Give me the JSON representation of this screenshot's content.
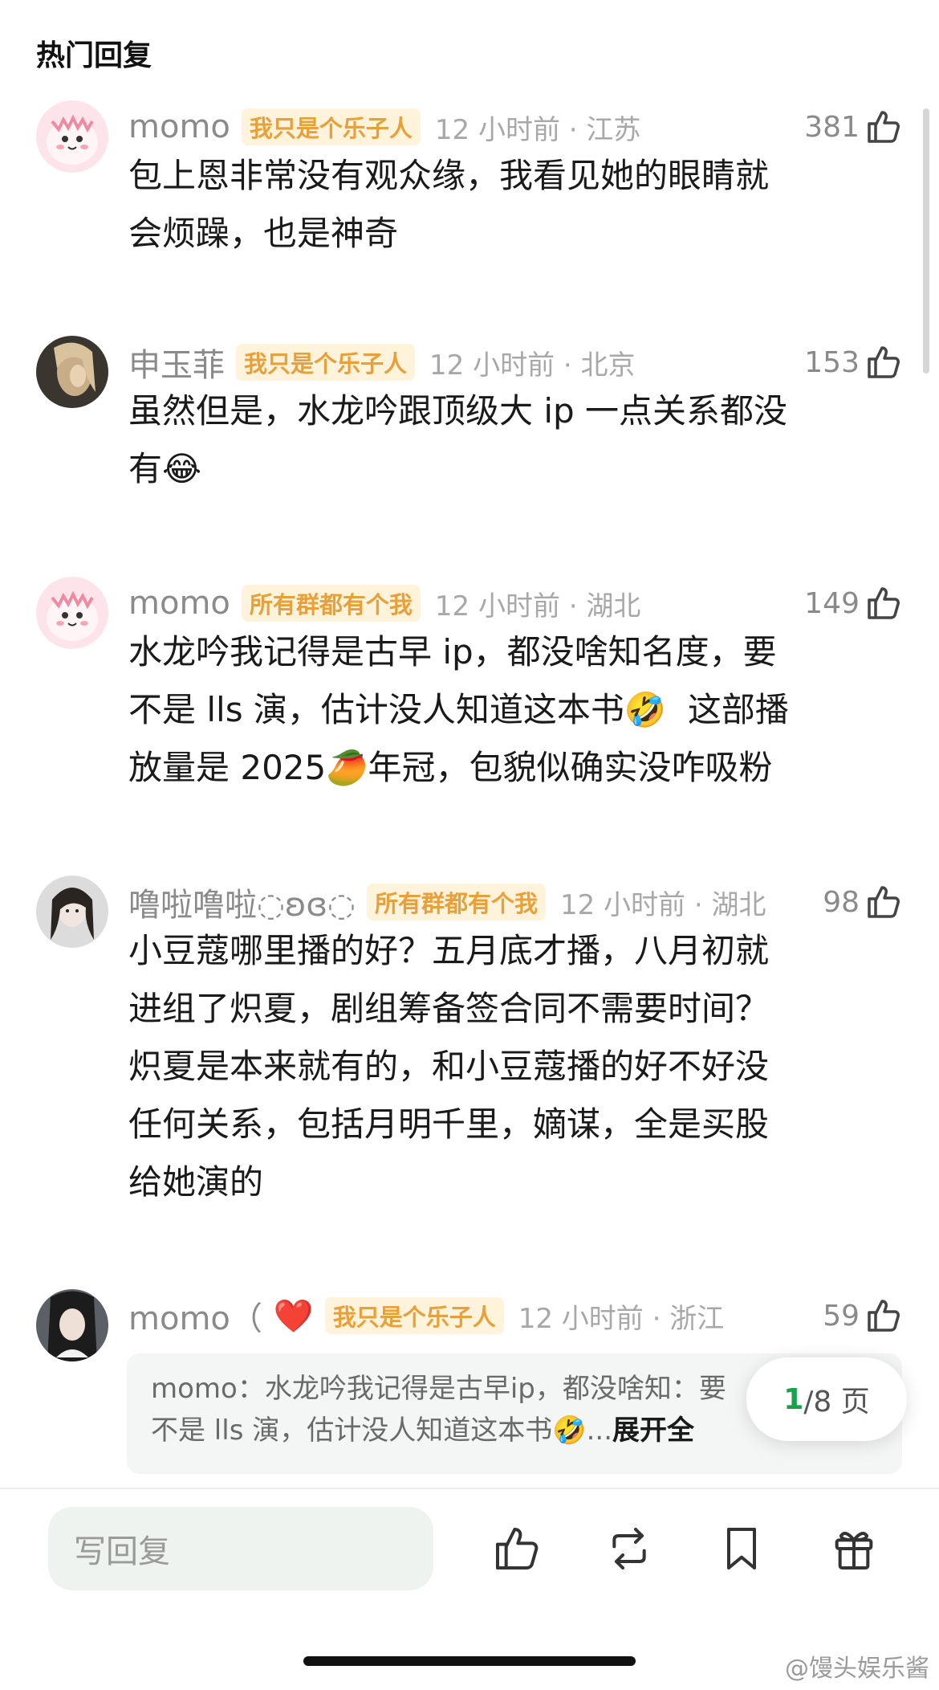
{
  "section_title": "热门回复",
  "comments": [
    {
      "username": "momo",
      "badge": "我只是个乐子人",
      "time_loc": "12 小时前 · 江苏",
      "likes": "381",
      "lines": [
        "包上恩非常没有观众缘，我看见她的眼睛就",
        "会烦躁，也是神奇"
      ]
    },
    {
      "username": "申玉菲",
      "badge": "我只是个乐子人",
      "time_loc": "12 小时前 · 北京",
      "likes": "153",
      "lines": [
        "虽然但是，水龙吟跟顶级大 ip 一点关系都没",
        "有"
      ],
      "emoji": "😂"
    },
    {
      "username": "momo",
      "badge": "所有群都有个我",
      "time_loc": "12 小时前 · 湖北",
      "likes": "149",
      "lines": [
        "水龙吟我记得是古早 ip，都没啥知名度，要",
        "不是 lls 演，估计没人知道这本书",
        "这部播",
        "放量是 2025",
        "年冠，包貌似确实没咋吸粉"
      ],
      "emojis": [
        "🤣",
        "🥭"
      ]
    },
    {
      "username": "噜啦噜啦◌ʚɞ◌",
      "badge": "所有群都有个我",
      "time_loc": "12 小时前 · 湖北",
      "likes": "98",
      "lines": [
        "小豆蔻哪里播的好？五月底才播，八月初就",
        "进组了炽夏，剧组筹备签合同不需要时间？",
        "炽夏是本来就有的，和小豆蔻播的好不好没",
        "任何关系，包括月明千里，嫡谋，全是买股",
        "给她演的"
      ]
    },
    {
      "username": "momo（",
      "heart": "❤️",
      "badge": "我只是个乐子人",
      "time_loc": "12 小时前 · 浙江",
      "likes": "59",
      "quote_line1": "momo：水龙吟我记得是古早ip，都没啥知",
      "quote_line2": "不是 lls 演，估计没人知道这本书",
      "quote_emoji": "🤣",
      "quote_ellipsis": "...",
      "expand": "展开全",
      "quote_tail": "：要"
    }
  ],
  "pager": {
    "current": "1",
    "total": "/8 页"
  },
  "reply_placeholder": "写回复",
  "watermark": "@馒头娱乐酱",
  "colors": {
    "badge_text": "#e8a13a",
    "badge_bg": "#fff3dc",
    "pager_current": "#1aa14e"
  },
  "icons": [
    "thumbs-up-icon",
    "repost-icon",
    "bookmark-icon",
    "gift-icon"
  ]
}
